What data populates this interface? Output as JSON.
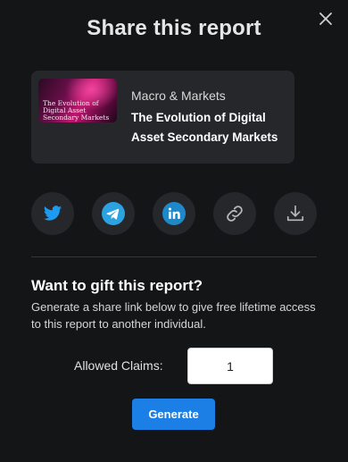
{
  "modal": {
    "title": "Share this report",
    "close_icon": "close-icon"
  },
  "report": {
    "thumbnail_text": "The Evolution of Digital Asset Secondary Markets",
    "category": "Macro & Markets",
    "title": "The Evolution of Digital Asset Secondary Markets"
  },
  "share": {
    "buttons": [
      {
        "icon": "twitter-icon",
        "color": "#1d9bf0"
      },
      {
        "icon": "telegram-icon",
        "color": "#2aa3e0"
      },
      {
        "icon": "linkedin-icon",
        "color": "#1f88c9"
      },
      {
        "icon": "link-icon",
        "color": "#b8b8b8"
      },
      {
        "icon": "download-icon",
        "color": "#b8b8b8"
      }
    ]
  },
  "gift": {
    "heading": "Want to gift this report?",
    "description": "Generate a share link below to give free lifetime access to this report to another individual.",
    "claims_label": "Allowed Claims:",
    "claims_value": "1",
    "generate_label": "Generate"
  },
  "colors": {
    "background": "#141517",
    "card": "#26272b",
    "accent": "#1b7fe6"
  }
}
